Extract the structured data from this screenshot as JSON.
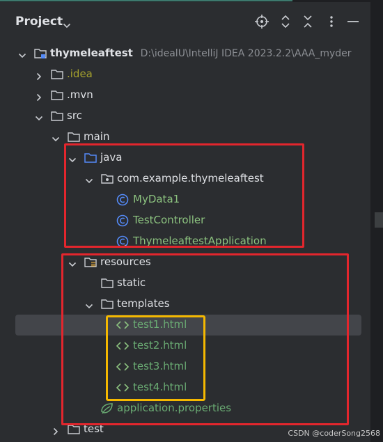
{
  "header": {
    "title": "Project"
  },
  "tree": {
    "root_name": "thymeleaftest",
    "root_path": "D:\\idealU\\IntelliJ IDEA 2023.2.2\\AAA_myder",
    "idea": ".idea",
    "mvn": ".mvn",
    "src": "src",
    "main": "main",
    "java": "java",
    "package": "com.example.thymeleaftest",
    "class1": "MyData1",
    "class2": "TestController",
    "class3": "ThymeleaftestApplication",
    "resources": "resources",
    "static": "static",
    "templates": "templates",
    "html1": "test1.html",
    "html2": "test2.html",
    "html3": "test3.html",
    "html4": "test4.html",
    "properties": "application.properties",
    "test": "test"
  },
  "watermark": "CSDN @coderSong2568",
  "colors": {
    "background": "#2b2d30",
    "red_highlight": "#e3262d",
    "yellow_highlight": "#f5b800",
    "html_green": "#6aab73",
    "class_icon_blue": "#548af7"
  }
}
